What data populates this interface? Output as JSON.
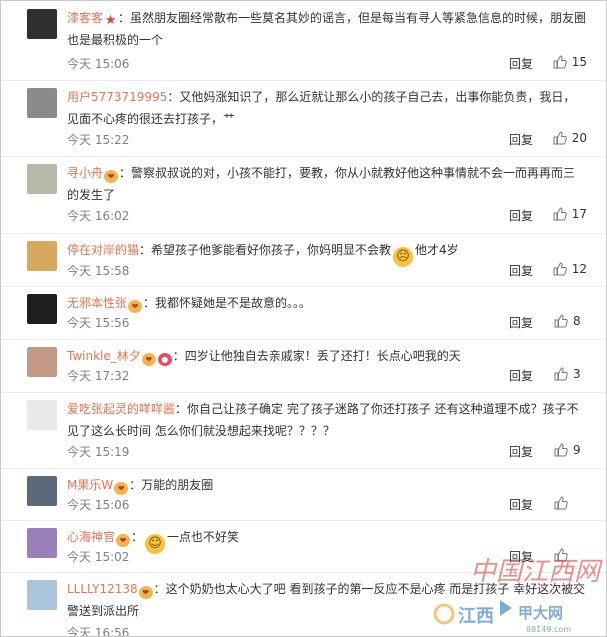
{
  "actions": {
    "reply_label": "回复"
  },
  "comments": [
    {
      "username": "漆客客",
      "badges": [
        "vip-star-icon"
      ],
      "text": "：虽然朋友圈经常散布一些莫名其妙的谣言，但是每当有寻人等紧急信息的时候，朋友圈也是最积极的一个",
      "text_after": "",
      "time": "今天 15:06",
      "likes": "15",
      "avatar_color": "#2f2f2f"
    },
    {
      "username": "用户5773719995",
      "badges": [],
      "text": "：又他妈涨知识了，那么近就让那么小的孩子自己去，出事你能负责，我日，见面不心疼的很还去打孩子，艹",
      "text_after": "",
      "time": "今天 15:22",
      "likes": "20",
      "avatar_color": "#8a8a8a"
    },
    {
      "username": "寻小舟",
      "badges": [
        "vip-heart-icon"
      ],
      "text": "：警察叔叔说的对，小孩不能打，要教，你从小就教好他这种事情就不会一而再再而三的发生了",
      "text_after": "",
      "time": "今天 16:02",
      "likes": "17",
      "avatar_color": "#b8b8a8"
    },
    {
      "username": "停在对岸的猫",
      "badges": [],
      "text": "：希望孩子他爹能看好你孩子，你妈明显不会教",
      "emoji": "sad-face-emoji",
      "text_after": "他才4岁",
      "time": "今天 15:58",
      "likes": "12",
      "avatar_color": "#d8a860"
    },
    {
      "username": "无邪本性张",
      "badges": [
        "vip-heart-icon"
      ],
      "text": "：我都怀疑她是不是故意的。。。",
      "text_after": "",
      "time": "今天 15:56",
      "likes": "8",
      "avatar_color": "#1f1f1f"
    },
    {
      "username": "Twinkle_林夕",
      "badges": [
        "vip-heart-icon",
        "balloon-icon"
      ],
      "text": "：四岁让他独自去亲戚家！丢了还打！长点心吧我的天",
      "text_after": "",
      "time": "今天 17:32",
      "likes": "3",
      "avatar_color": "#c49a86"
    },
    {
      "username": "爱吃张起灵的咩咩酱",
      "badges": [],
      "text": "：你自己让孩子确定 完了孩子迷路了你还打孩子 还有这种道理不成？孩子不见了这么长时间 怎么你们就没想起来找呢？？？？",
      "text_after": "",
      "time": "今天 15:19",
      "likes": "9",
      "avatar_color": "#e9e9e9"
    },
    {
      "username": "M果乐W",
      "badges": [
        "vip-heart-icon"
      ],
      "text": "：万能的朋友圈",
      "text_after": "",
      "time": "今天 15:06",
      "likes": "",
      "avatar_color": "#5a6a7a"
    },
    {
      "username": "心海神官",
      "badges": [
        "vip-heart-icon"
      ],
      "text": "：",
      "emoji": "sweat-smile-emoji",
      "text_after": "一点也不好笑",
      "time": "今天 15:02",
      "likes": "",
      "avatar_color": "#9b7fb8"
    },
    {
      "username": "LLLLY12138",
      "badges": [
        "vip-heart-icon"
      ],
      "text": "：这个奶奶也太心大了吧 看到孩子的第一反应不是心疼 而是打孩子 幸好这次被交警送到派出所",
      "text_after": "",
      "time": "今天 16:56",
      "likes": "",
      "avatar_color": "#a9c4dc"
    }
  ],
  "watermark": {
    "logo_text": "中国江西网",
    "sub_text": "江西",
    "site_text": "甲大网",
    "domain": "88149.com"
  }
}
